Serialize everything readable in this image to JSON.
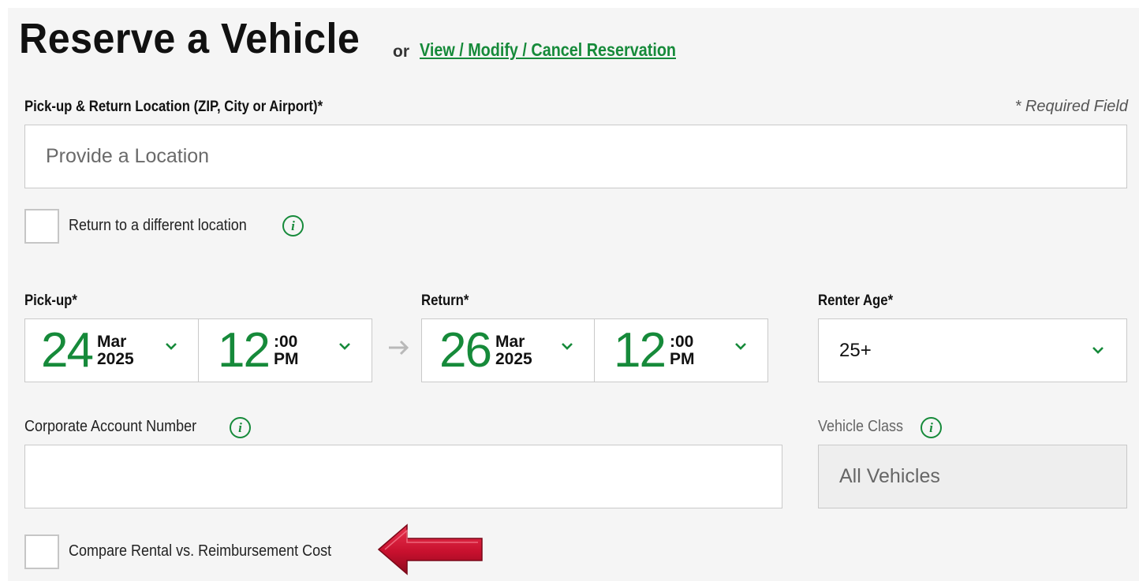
{
  "header": {
    "title": "Reserve a Vehicle",
    "or": "or",
    "manage_link": "View / Modify / Cancel Reservation"
  },
  "location": {
    "label": "Pick-up & Return Location (ZIP, City or Airport)*",
    "required_note": "* Required Field",
    "placeholder": "Provide a Location",
    "value": "",
    "different_return_label": "Return to a different location",
    "different_return_checked": false
  },
  "pickup": {
    "label": "Pick-up*",
    "day": "24",
    "month": "Mar",
    "year": "2025",
    "hour": "12",
    "minutes": ":00",
    "ampm": "PM"
  },
  "return": {
    "label": "Return*",
    "day": "26",
    "month": "Mar",
    "year": "2025",
    "hour": "12",
    "minutes": ":00",
    "ampm": "PM"
  },
  "renter_age": {
    "label": "Renter Age*",
    "value": "25+"
  },
  "corporate": {
    "label": "Corporate Account Number",
    "value": ""
  },
  "vehicle_class": {
    "label": "Vehicle Class",
    "value": "All Vehicles"
  },
  "compare": {
    "label": "Compare Rental vs. Reimbursement Cost",
    "checked": false
  },
  "icons": {
    "info": "i",
    "chevron": "chevron-down-icon",
    "arrow": "arrow-right-icon",
    "annotation": "red-arrow-left-icon"
  },
  "colors": {
    "accent": "#168a3a",
    "panel_bg": "#f5f5f5",
    "annotation_red": "#c8102e"
  }
}
